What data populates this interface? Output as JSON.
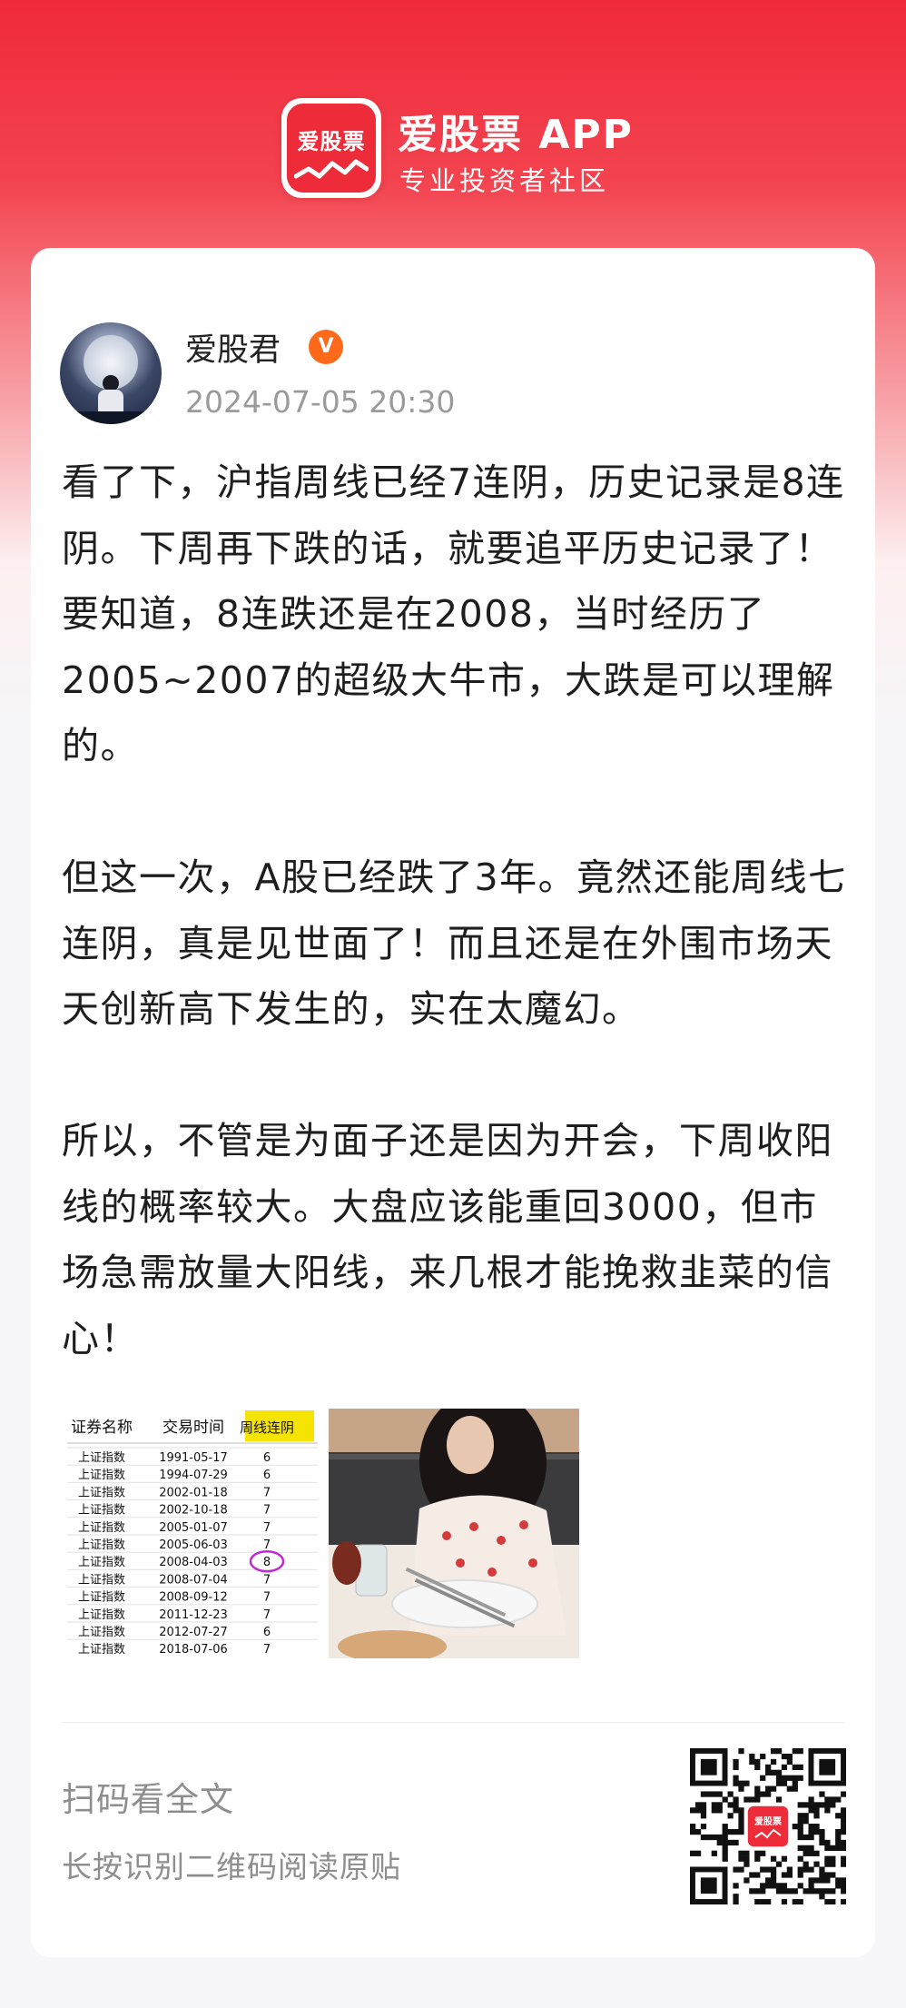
{
  "header": {
    "logo_text": "爱股票",
    "app_name": "爱股票 APP",
    "tagline": "专业投资者社区",
    "brand_color": "#ee2b38"
  },
  "post": {
    "username": "爱股君",
    "verified_badge": "V",
    "timestamp": "2024-07-05 20:30",
    "paragraphs": [
      "看了下，沪指周线已经7连阴，历史记录是8连阴。下周再下跌的话，就要追平历史记录了！要知道，8连跌还是在2008，当时经历了2005~2007的超级大牛市，大跌是可以理解的。",
      "但这一次，A股已经跌了3年。竟然还能周线七连阴，真是见世面了！而且还是在外围市场天天创新高下发生的，实在太魔幻。",
      "所以，不管是为面子还是因为开会，下周收阳线的概率较大。大盘应该能重回3000，但市场急需放量大阳线，来几根才能挽救韭菜的信心！"
    ],
    "images": [
      {
        "type": "table",
        "headers": [
          "证券名称",
          "交易时间",
          "周线连阴"
        ],
        "rows": [
          [
            "上证指数",
            "1991-05-17",
            "6"
          ],
          [
            "上证指数",
            "1994-07-29",
            "6"
          ],
          [
            "上证指数",
            "2002-01-18",
            "7"
          ],
          [
            "上证指数",
            "2002-10-18",
            "7"
          ],
          [
            "上证指数",
            "2005-01-07",
            "7"
          ],
          [
            "上证指数",
            "2005-06-03",
            "7"
          ],
          [
            "上证指数",
            "2008-04-03",
            "8"
          ],
          [
            "上证指数",
            "2008-07-04",
            "7"
          ],
          [
            "上证指数",
            "2008-09-12",
            "7"
          ],
          [
            "上证指数",
            "2011-12-23",
            "7"
          ],
          [
            "上证指数",
            "2012-07-27",
            "6"
          ],
          [
            "上证指数",
            "2018-07-06",
            "7"
          ]
        ],
        "highlight_color": "#f5e400",
        "circle_color": "#c02ad0"
      },
      {
        "type": "photo",
        "subject": "woman-at-cafe-table"
      }
    ]
  },
  "footer": {
    "scan_title": "扫码看全文",
    "scan_subtitle": "长按识别二维码阅读原贴",
    "qr_center_text": "爱股票"
  }
}
